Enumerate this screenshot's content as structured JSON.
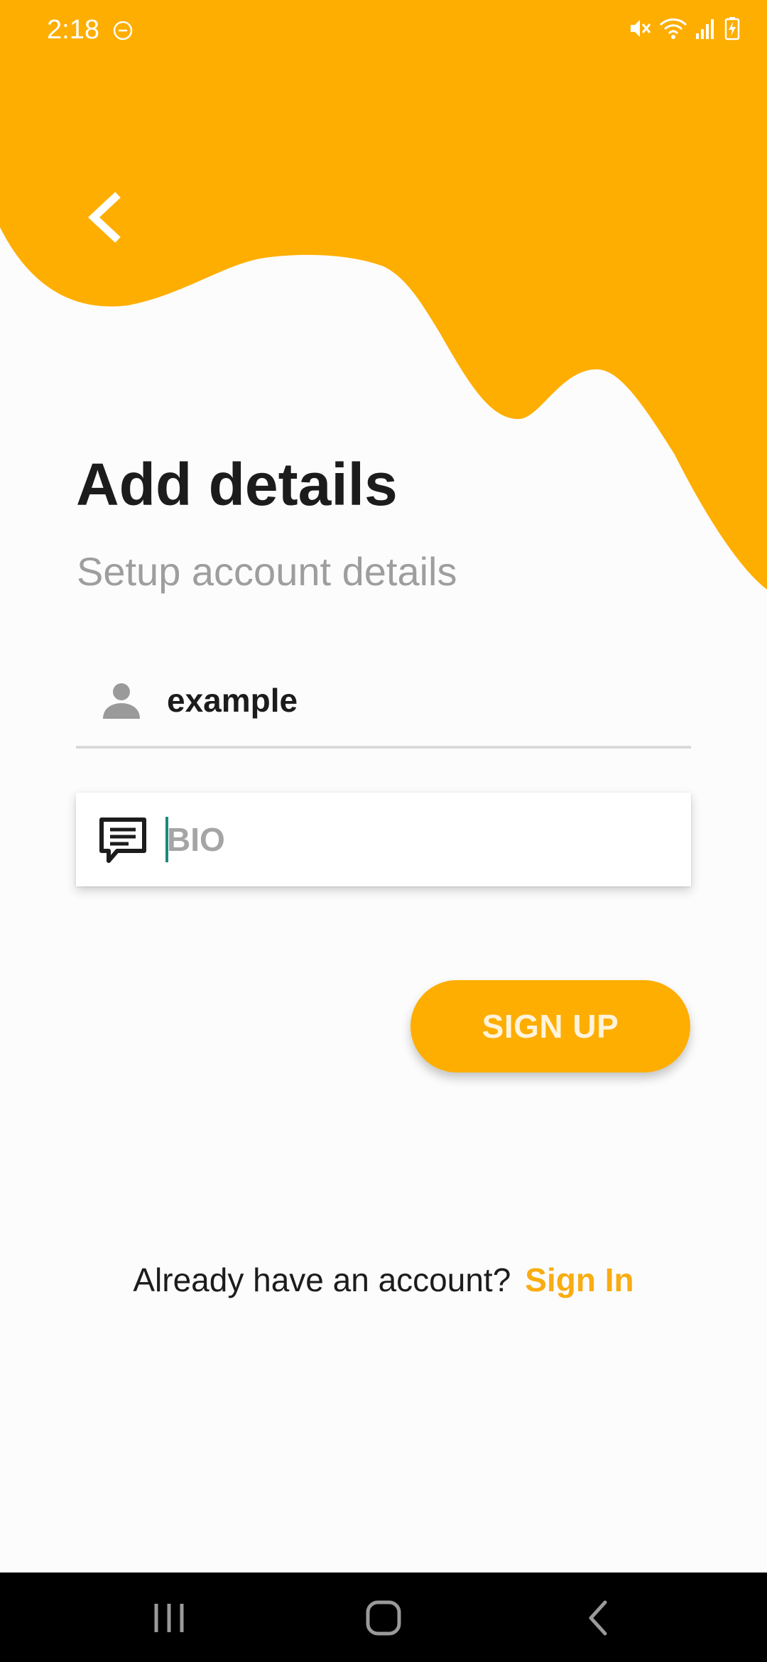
{
  "colors": {
    "accent": "#feae00",
    "background": "#fcfcfc",
    "title_text": "#1c1c1c",
    "subtitle_text": "#9e9e9e",
    "link": "#f9ad12",
    "cursor": "#1b8a7c"
  },
  "status_bar": {
    "time": "2:18",
    "icons": [
      "do-not-disturb-icon",
      "mute-icon",
      "wifi-icon",
      "signal-icon",
      "battery-charging-icon"
    ]
  },
  "header": {
    "back_icon": "chevron-left-icon"
  },
  "main": {
    "title": "Add details",
    "subtitle": "Setup account details",
    "username": {
      "icon": "person-icon",
      "value": "example"
    },
    "bio": {
      "icon": "comment-icon",
      "value": "",
      "placeholder": "BIO"
    },
    "signup_label": "SIGN UP"
  },
  "footer": {
    "question": "Already have an account?",
    "signin_label": "Sign In"
  },
  "nav_bar": {
    "buttons": [
      "recent-apps-icon",
      "home-icon",
      "back-icon"
    ]
  }
}
